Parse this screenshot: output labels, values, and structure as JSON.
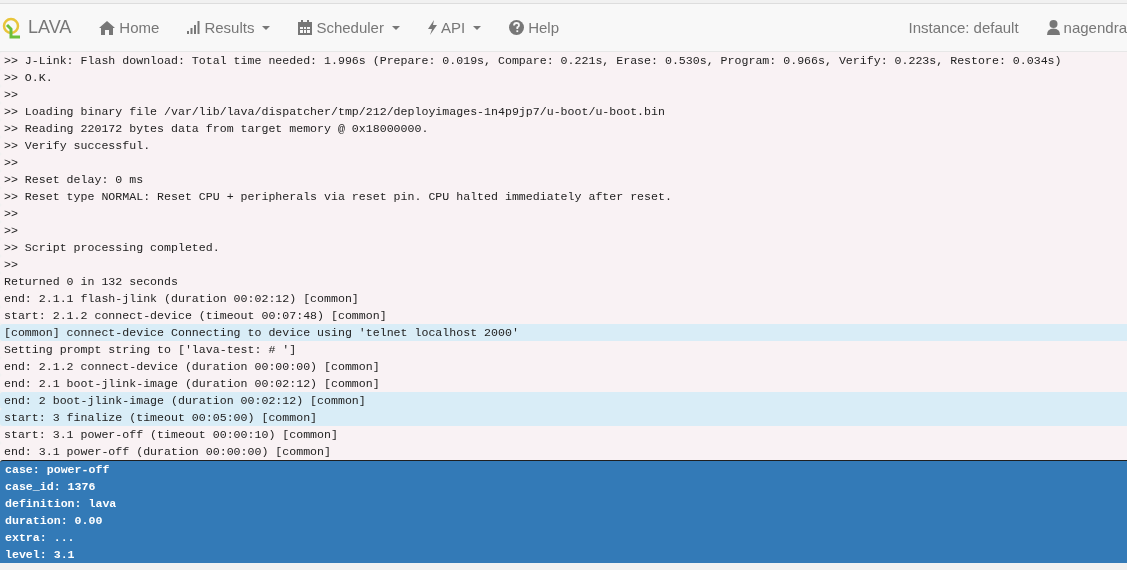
{
  "navbar": {
    "brand": "LAVA",
    "items": [
      {
        "label": "Home",
        "kind": "home",
        "dropdown": false
      },
      {
        "label": "Results",
        "kind": "results",
        "dropdown": true
      },
      {
        "label": "Scheduler",
        "kind": "scheduler",
        "dropdown": true
      },
      {
        "label": "API",
        "kind": "api",
        "dropdown": true
      },
      {
        "label": "Help",
        "kind": "help",
        "dropdown": false
      }
    ],
    "instance": "Instance: default",
    "user": "nagendra"
  },
  "log": [
    {
      "text": ">> J-Link: Flash download: Total time needed: 1.996s (Prepare: 0.019s, Compare: 0.221s, Erase: 0.530s, Program: 0.966s, Verify: 0.223s, Restore: 0.034s)",
      "kind": "target"
    },
    {
      "text": ">> O.K.",
      "kind": "target"
    },
    {
      "text": ">>",
      "kind": "target"
    },
    {
      "text": ">> Loading binary file /var/lib/lava/dispatcher/tmp/212/deployimages-1n4p9jp7/u-boot/u-boot.bin",
      "kind": "target"
    },
    {
      "text": ">> Reading 220172 bytes data from target memory @ 0x18000000.",
      "kind": "target"
    },
    {
      "text": ">> Verify successful.",
      "kind": "target"
    },
    {
      "text": ">>",
      "kind": "target"
    },
    {
      "text": ">> Reset delay: 0 ms",
      "kind": "target"
    },
    {
      "text": ">> Reset type NORMAL: Reset CPU + peripherals via reset pin. CPU halted immediately after reset.",
      "kind": "target"
    },
    {
      "text": ">>",
      "kind": "target"
    },
    {
      "text": ">>",
      "kind": "target"
    },
    {
      "text": ">> Script processing completed.",
      "kind": "target"
    },
    {
      "text": ">>",
      "kind": "target"
    },
    {
      "text": "Returned 0 in 132 seconds",
      "kind": "debug"
    },
    {
      "text": "end: 2.1.1 flash-jlink (duration 00:02:12) [common]",
      "kind": "debug"
    },
    {
      "text": "start: 2.1.2 connect-device (timeout 00:07:48) [common]",
      "kind": "debug"
    },
    {
      "text": "[common] connect-device Connecting to device using 'telnet localhost 2000'",
      "kind": "info"
    },
    {
      "text": "Setting prompt string to ['lava-test: # ']",
      "kind": "debug"
    },
    {
      "text": "end: 2.1.2 connect-device (duration 00:00:00) [common]",
      "kind": "debug"
    },
    {
      "text": "end: 2.1 boot-jlink-image (duration 00:02:12) [common]",
      "kind": "debug"
    },
    {
      "text": "end: 2 boot-jlink-image (duration 00:02:12) [common]",
      "kind": "info"
    },
    {
      "text": "start: 3 finalize (timeout 00:05:00) [common]",
      "kind": "info"
    },
    {
      "text": "start: 3.1 power-off (timeout 00:00:10) [common]",
      "kind": "debug"
    },
    {
      "text": "end: 3.1 power-off (duration 00:00:00) [common]",
      "kind": "debug"
    }
  ],
  "result": {
    "lines": [
      "case: power-off",
      "case_id: 1376",
      "definition: lava",
      "duration: 0.00",
      "extra: ...",
      "level: 3.1"
    ]
  }
}
